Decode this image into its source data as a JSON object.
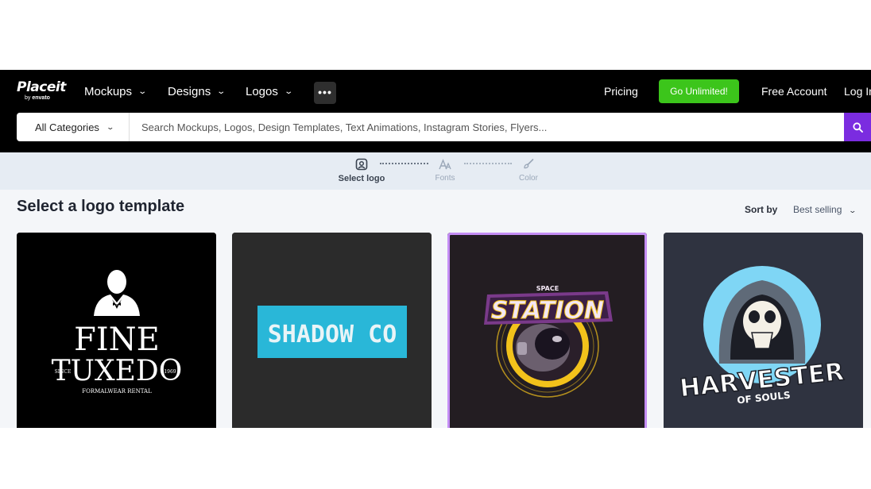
{
  "header": {
    "logo_word": "Placeit",
    "logo_by": "by",
    "logo_brand": "envato",
    "nav": [
      {
        "label": "Mockups"
      },
      {
        "label": "Designs"
      },
      {
        "label": "Logos"
      }
    ],
    "more_label": "•••",
    "pricing": "Pricing",
    "go_unlimited": "Go Unlimited!",
    "free_account": "Free Account",
    "log_in": "Log In"
  },
  "search": {
    "category": "All Categories",
    "placeholder": "Search Mockups, Logos, Design Templates, Text Animations, Instagram Stories, Flyers...",
    "button_icon": "search-icon"
  },
  "steps": [
    {
      "label": "Select logo",
      "icon": "logo-select-icon",
      "active": true
    },
    {
      "label": "Fonts",
      "icon": "fonts-icon",
      "active": false
    },
    {
      "label": "Color",
      "icon": "paint-brush-icon",
      "active": false
    }
  ],
  "main": {
    "title": "Select a logo template",
    "sort_label": "Sort by",
    "sort_value": "Best selling"
  },
  "templates": [
    {
      "line1": "FINE",
      "line2": "TUXEDO",
      "left": "SINCE",
      "right": "1969",
      "tagline": "FORMALWEAR RENTAL",
      "bg": "#000000"
    },
    {
      "text": "SHADOW CO",
      "bg": "#2b2b2b",
      "accent": "#29b7d8"
    },
    {
      "small": "SPACE",
      "text": "STATION",
      "bg": "#231d22",
      "accent": "#f2c21b"
    },
    {
      "text": "HARVESTER",
      "sub": "OF SOULS",
      "bg": "#2f3340",
      "accent": "#7fd6f5"
    }
  ],
  "colors": {
    "accent_green": "#3cc51b",
    "accent_purple": "#7b2ce0",
    "selected_outline": "#c48df5"
  }
}
